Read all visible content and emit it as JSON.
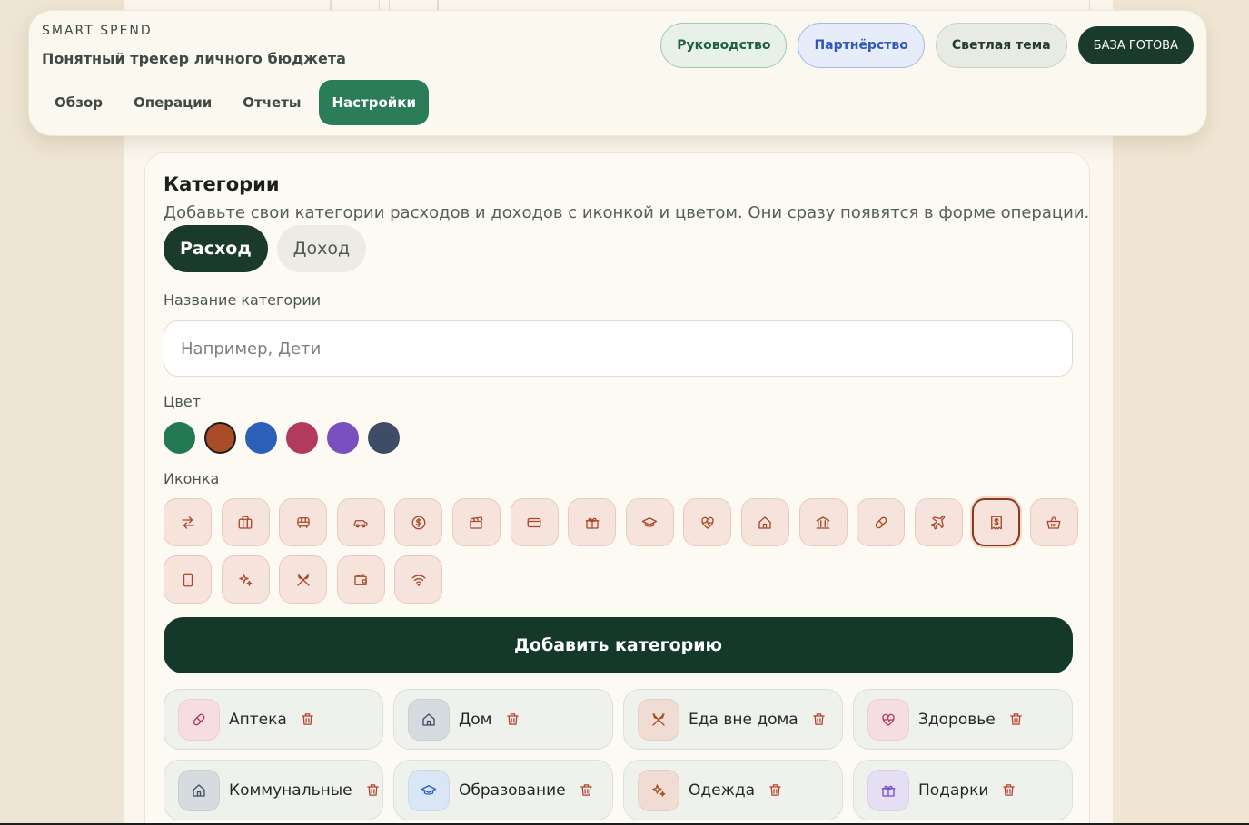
{
  "header": {
    "kicker": "SMART SPEND",
    "tagline": "Понятный трекер личного бюджета",
    "nav": [
      {
        "label": "Обзор",
        "active": false
      },
      {
        "label": "Операции",
        "active": false
      },
      {
        "label": "Отчеты",
        "active": false
      },
      {
        "label": "Настройки",
        "active": true
      }
    ],
    "actions": {
      "guide": "Руководство",
      "partner": "Партнёрство",
      "theme": "Светлая тема",
      "db_status": "БАЗА ГОТОВА"
    }
  },
  "categories_card": {
    "title": "Категории",
    "description": "Добавьте свои категории расходов и доходов с иконкой и цветом. Они сразу появятся в форме операции.",
    "type_toggle": {
      "expense": "Расход",
      "income": "Доход",
      "selected": "expense"
    },
    "name_label": "Название категории",
    "name_placeholder": "Например, Дети",
    "name_value": "",
    "color_label": "Цвет",
    "colors": [
      "#23794f",
      "#a84d28",
      "#2b5fb8",
      "#b23a5f",
      "#7a4fc0",
      "#3e4c66"
    ],
    "selected_color": "#a84d28",
    "icon_label": "Иконка",
    "icons": [
      "transfer-icon",
      "briefcase-icon",
      "bus-icon",
      "car-icon",
      "dollar-coin-icon",
      "clapperboard-icon",
      "credit-card-icon",
      "gift-icon",
      "graduation-cap-icon",
      "heart-pulse-icon",
      "home-icon",
      "bank-icon",
      "pill-icon",
      "plane-icon",
      "receipt-icon",
      "basket-icon",
      "phone-icon",
      "sparkles-icon",
      "utensils-icon",
      "wallet-icon",
      "wifi-icon"
    ],
    "selected_icon": "receipt-icon",
    "add_button": "Добавить категорию",
    "existing": [
      {
        "name": "Аптека",
        "icon": "pill-icon",
        "color": "#b23a5f",
        "bg": "#f5dde2"
      },
      {
        "name": "Дом",
        "icon": "home-icon",
        "color": "#3e4c66",
        "bg": "#d6dbdf"
      },
      {
        "name": "Еда вне дома",
        "icon": "utensils-icon",
        "color": "#a84d28",
        "bg": "#f0dcd2"
      },
      {
        "name": "Здоровье",
        "icon": "heart-pulse-icon",
        "color": "#b23a5f",
        "bg": "#f5dde2"
      },
      {
        "name": "Коммунальные",
        "icon": "home-icon",
        "color": "#3e4c66",
        "bg": "#d6dbdf"
      },
      {
        "name": "Образование",
        "icon": "graduation-cap-icon",
        "color": "#2b5fb8",
        "bg": "#d8e6f5"
      },
      {
        "name": "Одежда",
        "icon": "sparkles-icon",
        "color": "#a84d28",
        "bg": "#f0dcd2"
      },
      {
        "name": "Подарки",
        "icon": "gift-icon",
        "color": "#7a4fc0",
        "bg": "#e6def3"
      }
    ],
    "delete_icon": "trash-icon"
  }
}
